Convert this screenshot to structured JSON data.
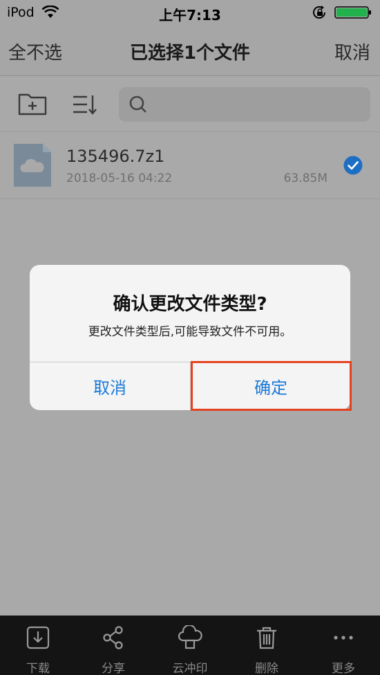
{
  "status_bar": {
    "carrier": "iPod",
    "time": "上午7:13"
  },
  "nav": {
    "left_label": "全不选",
    "title": "已选择1个文件",
    "right_label": "取消"
  },
  "file": {
    "name": "135496.7z1",
    "date": "2018-05-16 04:22",
    "size": "63.85M",
    "selected": true
  },
  "dialog": {
    "title": "确认更改文件类型?",
    "message": "更改文件类型后,可能导致文件不可用。",
    "cancel_label": "取消",
    "confirm_label": "确定"
  },
  "bottom_tabs": [
    {
      "label": "下载",
      "icon": "download-icon"
    },
    {
      "label": "分享",
      "icon": "share-icon"
    },
    {
      "label": "云冲印",
      "icon": "cloud-print-icon"
    },
    {
      "label": "删除",
      "icon": "trash-icon"
    },
    {
      "label": "更多",
      "icon": "more-icon"
    }
  ],
  "colors": {
    "accent_blue": "#1d7ad6",
    "highlight_red": "#e4421f",
    "dim_background": "#a9a9a9",
    "bottom_bar": "#141414"
  }
}
